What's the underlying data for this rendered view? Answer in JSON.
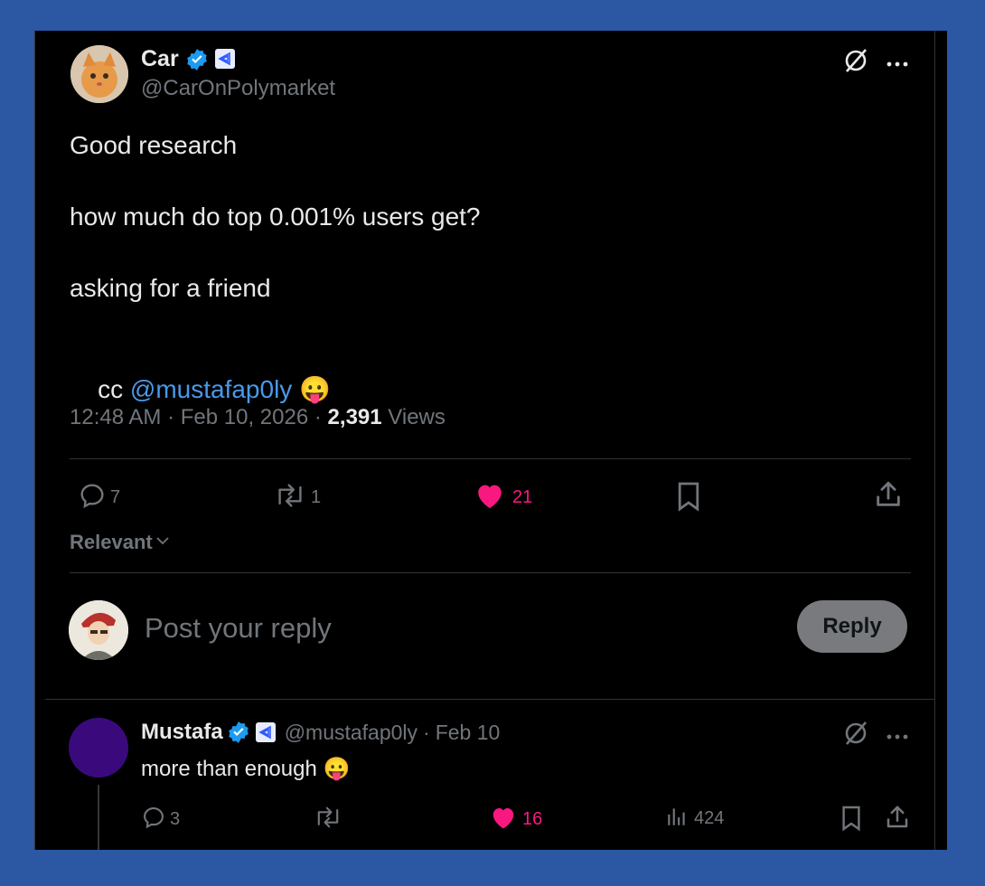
{
  "main_post": {
    "author_name": "Car",
    "author_handle": "@CarOnPolymarket",
    "lines": [
      "Good research",
      "how much do top 0.001% users get?",
      "asking for a friend"
    ],
    "cc_prefix": "cc ",
    "mention": "@mustafap0ly",
    "emoji": "😛",
    "time": "12:48 AM",
    "separator": "·",
    "date": "Feb 10, 2026",
    "views_count": "2,391",
    "views_label": "Views",
    "replies": "7",
    "reposts": "1",
    "likes": "21"
  },
  "sort": {
    "label": "Relevant"
  },
  "composer": {
    "placeholder": "Post your reply",
    "button": "Reply"
  },
  "reply": {
    "author_name": "Mustafa",
    "author_handle": "@mustafap0ly",
    "separator": "·",
    "date": "Feb 10",
    "text": "more than enough",
    "emoji": "😛",
    "replies": "3",
    "likes": "16",
    "views": "424"
  },
  "colors": {
    "background_outer": "#2b57a3",
    "card": "#000000",
    "like_pink": "#f91880",
    "verified_blue": "#1d9bf0",
    "reply_avatar": "#3a0a7d"
  }
}
